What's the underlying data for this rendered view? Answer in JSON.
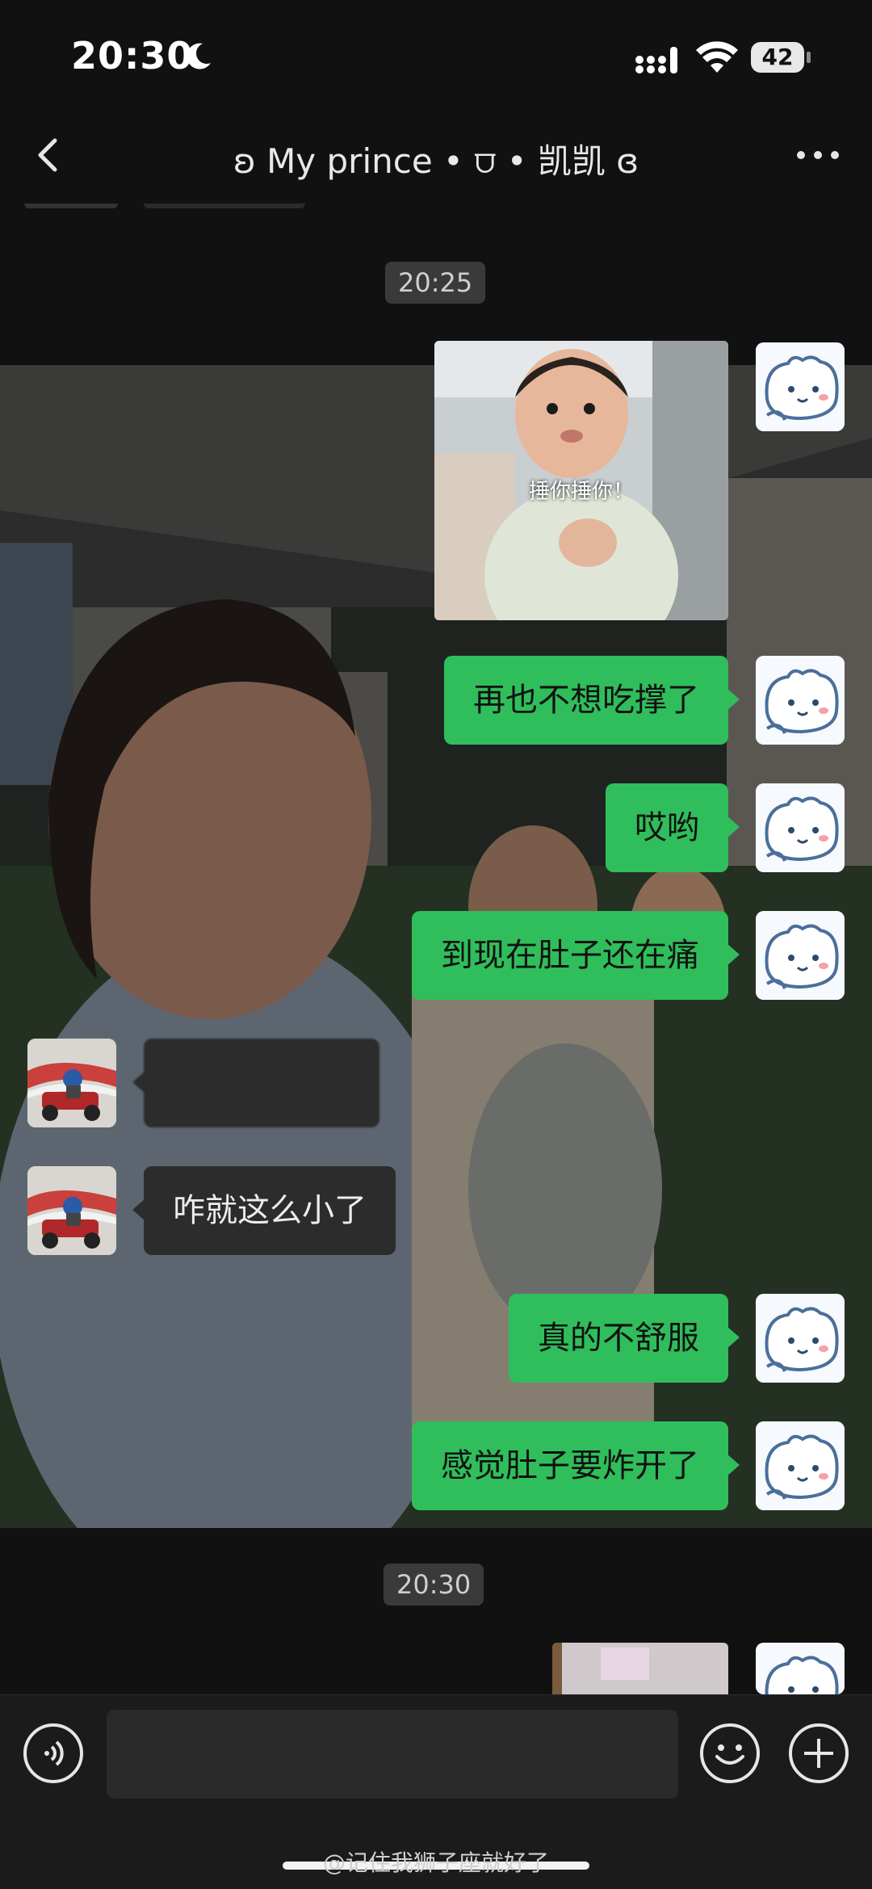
{
  "status_bar": {
    "time": "20:30",
    "battery": "42"
  },
  "header": {
    "title": "ʚ My prince • ⩌ • 凯凯 ɞ"
  },
  "timestamps": [
    "20:25",
    "20:30"
  ],
  "sticker_caption": "捶你捶你！",
  "messages": {
    "m1": "再也不想吃撑了",
    "m2": "哎哟",
    "m3": "到现在肚子还在痛",
    "m4": "",
    "m5": "咋就这么小了",
    "m6": "真的不舒服",
    "m7": "感觉肚子要炸开了"
  },
  "watermark": "@记住我狮子座就好了",
  "colors": {
    "outgoing_bubble": "#2fbe5b",
    "incoming_bubble": "#2c2c2c",
    "background": "#111111"
  }
}
